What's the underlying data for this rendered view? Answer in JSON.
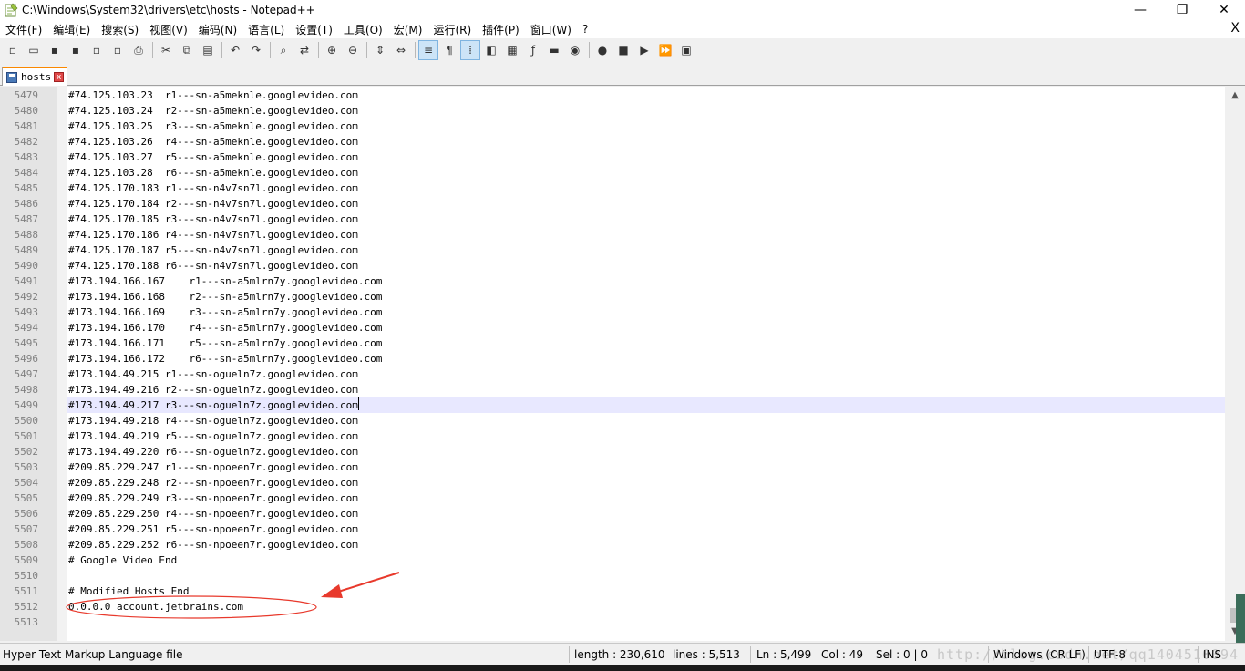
{
  "window": {
    "title": "C:\\Windows\\System32\\drivers\\etc\\hosts - Notepad++",
    "minimize": "—",
    "maximize": "❐",
    "close": "✕"
  },
  "menu": {
    "items": [
      "文件(F)",
      "编辑(E)",
      "搜索(S)",
      "视图(V)",
      "编码(N)",
      "语言(L)",
      "设置(T)",
      "工具(O)",
      "宏(M)",
      "运行(R)",
      "插件(P)",
      "窗口(W)",
      "?"
    ],
    "close": "X"
  },
  "toolbar": {
    "groups": [
      [
        {
          "name": "new-file-icon",
          "glyph": "▫"
        },
        {
          "name": "open-file-icon",
          "glyph": "▭"
        },
        {
          "name": "save-icon",
          "glyph": "▪"
        },
        {
          "name": "save-all-icon",
          "glyph": "▪"
        },
        {
          "name": "close-file-icon",
          "glyph": "▫"
        },
        {
          "name": "close-all-icon",
          "glyph": "▫"
        },
        {
          "name": "print-icon",
          "glyph": "⎙"
        }
      ],
      [
        {
          "name": "cut-icon",
          "glyph": "✂"
        },
        {
          "name": "copy-icon",
          "glyph": "⧉"
        },
        {
          "name": "paste-icon",
          "glyph": "▤"
        }
      ],
      [
        {
          "name": "undo-icon",
          "glyph": "↶"
        },
        {
          "name": "redo-icon",
          "glyph": "↷"
        }
      ],
      [
        {
          "name": "find-icon",
          "glyph": "⌕"
        },
        {
          "name": "replace-icon",
          "glyph": "⇄"
        }
      ],
      [
        {
          "name": "zoom-in-icon",
          "glyph": "⊕"
        },
        {
          "name": "zoom-out-icon",
          "glyph": "⊖"
        }
      ],
      [
        {
          "name": "sync-vertical-icon",
          "glyph": "⇕"
        },
        {
          "name": "sync-horizontal-icon",
          "glyph": "⇔"
        }
      ],
      [
        {
          "name": "word-wrap-icon",
          "glyph": "≡",
          "active": true
        },
        {
          "name": "show-all-chars-icon",
          "glyph": "¶"
        },
        {
          "name": "indent-guide-icon",
          "glyph": "⁞",
          "active": true
        },
        {
          "name": "user-language-icon",
          "glyph": "◧"
        },
        {
          "name": "doc-map-icon",
          "glyph": "▦"
        },
        {
          "name": "function-list-icon",
          "glyph": "ƒ"
        },
        {
          "name": "folder-workspace-icon",
          "glyph": "▬"
        },
        {
          "name": "monitoring-icon",
          "glyph": "◉"
        }
      ],
      [
        {
          "name": "record-macro-icon",
          "glyph": "●"
        },
        {
          "name": "stop-macro-icon",
          "glyph": "■"
        },
        {
          "name": "play-macro-icon",
          "glyph": "▶"
        },
        {
          "name": "run-macro-multiple-icon",
          "glyph": "⏩"
        },
        {
          "name": "save-macro-icon",
          "glyph": "▣"
        }
      ]
    ]
  },
  "tab": {
    "label": "hosts",
    "close": "x"
  },
  "editor": {
    "current_line": "5499",
    "lines": [
      {
        "no": "5479",
        "text": "#74.125.103.23  r1---sn-a5meknle.googlevideo.com"
      },
      {
        "no": "5480",
        "text": "#74.125.103.24  r2---sn-a5meknle.googlevideo.com"
      },
      {
        "no": "5481",
        "text": "#74.125.103.25  r3---sn-a5meknle.googlevideo.com"
      },
      {
        "no": "5482",
        "text": "#74.125.103.26  r4---sn-a5meknle.googlevideo.com"
      },
      {
        "no": "5483",
        "text": "#74.125.103.27  r5---sn-a5meknle.googlevideo.com"
      },
      {
        "no": "5484",
        "text": "#74.125.103.28  r6---sn-a5meknle.googlevideo.com"
      },
      {
        "no": "5485",
        "text": "#74.125.170.183 r1---sn-n4v7sn7l.googlevideo.com"
      },
      {
        "no": "5486",
        "text": "#74.125.170.184 r2---sn-n4v7sn7l.googlevideo.com"
      },
      {
        "no": "5487",
        "text": "#74.125.170.185 r3---sn-n4v7sn7l.googlevideo.com"
      },
      {
        "no": "5488",
        "text": "#74.125.170.186 r4---sn-n4v7sn7l.googlevideo.com"
      },
      {
        "no": "5489",
        "text": "#74.125.170.187 r5---sn-n4v7sn7l.googlevideo.com"
      },
      {
        "no": "5490",
        "text": "#74.125.170.188 r6---sn-n4v7sn7l.googlevideo.com"
      },
      {
        "no": "5491",
        "text": "#173.194.166.167    r1---sn-a5mlrn7y.googlevideo.com"
      },
      {
        "no": "5492",
        "text": "#173.194.166.168    r2---sn-a5mlrn7y.googlevideo.com"
      },
      {
        "no": "5493",
        "text": "#173.194.166.169    r3---sn-a5mlrn7y.googlevideo.com"
      },
      {
        "no": "5494",
        "text": "#173.194.166.170    r4---sn-a5mlrn7y.googlevideo.com"
      },
      {
        "no": "5495",
        "text": "#173.194.166.171    r5---sn-a5mlrn7y.googlevideo.com"
      },
      {
        "no": "5496",
        "text": "#173.194.166.172    r6---sn-a5mlrn7y.googlevideo.com"
      },
      {
        "no": "5497",
        "text": "#173.194.49.215 r1---sn-ogueln7z.googlevideo.com"
      },
      {
        "no": "5498",
        "text": "#173.194.49.216 r2---sn-ogueln7z.googlevideo.com"
      },
      {
        "no": "5499",
        "text": "#173.194.49.217 r3---sn-ogueln7z.googlevideo.com"
      },
      {
        "no": "5500",
        "text": "#173.194.49.218 r4---sn-ogueln7z.googlevideo.com"
      },
      {
        "no": "5501",
        "text": "#173.194.49.219 r5---sn-ogueln7z.googlevideo.com"
      },
      {
        "no": "5502",
        "text": "#173.194.49.220 r6---sn-ogueln7z.googlevideo.com"
      },
      {
        "no": "5503",
        "text": "#209.85.229.247 r1---sn-npoeen7r.googlevideo.com"
      },
      {
        "no": "5504",
        "text": "#209.85.229.248 r2---sn-npoeen7r.googlevideo.com"
      },
      {
        "no": "5505",
        "text": "#209.85.229.249 r3---sn-npoeen7r.googlevideo.com"
      },
      {
        "no": "5506",
        "text": "#209.85.229.250 r4---sn-npoeen7r.googlevideo.com"
      },
      {
        "no": "5507",
        "text": "#209.85.229.251 r5---sn-npoeen7r.googlevideo.com"
      },
      {
        "no": "5508",
        "text": "#209.85.229.252 r6---sn-npoeen7r.googlevideo.com"
      },
      {
        "no": "5509",
        "text": "# Google Video End"
      },
      {
        "no": "5510",
        "text": ""
      },
      {
        "no": "5511",
        "text": "# Modified Hosts End"
      },
      {
        "no": "5512",
        "text": "0.0.0.0 account.jetbrains.com"
      },
      {
        "no": "5513",
        "text": ""
      }
    ]
  },
  "statusbar": {
    "file_type": "Hyper Text Markup Language file",
    "length": "length : 230,610",
    "lines": "lines : 5,513",
    "ln": "Ln : 5,499",
    "col": "Col : 49",
    "sel": "Sel : 0 | 0",
    "eol": "Windows (CR LF)",
    "encoding": "UTF-8",
    "mode": "INS",
    "watermark": "http://blog.csdn.net/qq1404510094"
  },
  "colors": {
    "annotation": "#e8392c",
    "current_line_bg": "#e8e8ff",
    "tab_accent": "#fa8800"
  }
}
